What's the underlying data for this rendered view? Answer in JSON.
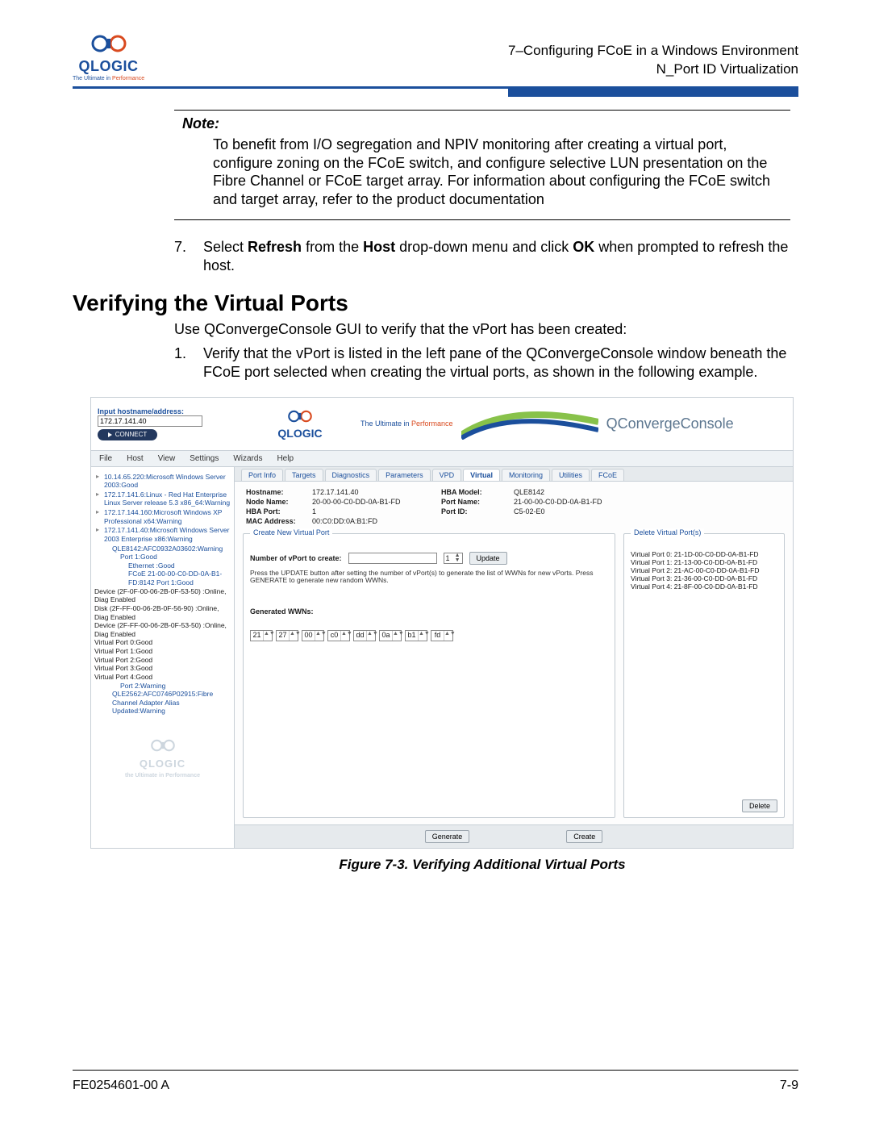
{
  "header": {
    "logo_text": "QLOGIC",
    "logo_sub_pre": "The Ultimate in ",
    "logo_sub_perf": "Performance",
    "line1": "7–Configuring FCoE in a Windows Environment",
    "line2": "N_Port ID Virtualization"
  },
  "note": {
    "title": "Note:",
    "body": "To benefit from I/O segregation and NPIV monitoring after creating a virtual port, configure zoning on the FCoE switch, and configure selective LUN presentation on the Fibre Channel or FCoE target array. For information about configuring the FCoE switch and target array, refer to the product documentation"
  },
  "step7": {
    "num": "7.",
    "pre": "Select ",
    "b1": "Refresh",
    "mid": " from the ",
    "b2": "Host",
    "mid2": " drop-down menu and click ",
    "b3": "OK",
    "post": " when prompted to refresh the host."
  },
  "section_title": "Verifying the Virtual Ports",
  "intro": "Use QConvergeConsole GUI to verify that the vPort has been created:",
  "step1": {
    "num": "1.",
    "text": "Verify that the vPort is listed in the left pane of the QConvergeConsole window beneath the FCoE port selected when creating the virtual ports, as shown in the following example."
  },
  "shot": {
    "addr_label": "Input hostname/address:",
    "addr_value": "172.17.141.40",
    "connect": "CONNECT",
    "brand_big": "QLOGIC",
    "tag_pre": "The Ultimate in ",
    "tag_perf": "Performance",
    "qcc": "QConvergeConsole",
    "menubar": [
      "File",
      "Host",
      "View",
      "Settings",
      "Wizards",
      "Help"
    ],
    "tree": [
      "10.14.65.220:Microsoft Windows Server 2003:Good",
      "172.17.141.6:Linux - Red Hat Enterprise Linux Server release 5.3 x86_64:Warning",
      "172.17.144.160:Microsoft Windows XP Professional x64:Warning",
      "172.17.141.40:Microsoft Windows Server 2003 Enterprise x86:Warning",
      "  QLE8142:AFC0932A03602:Warning",
      "    Port 1:Good",
      "      Ethernet :Good",
      "      FCoE 21-00-00-C0-DD-0A-B1-FD:8142 Port 1:Good",
      "        Device (2F-0F-00-06-2B-0F-53-50) :Online, Diag Enabled",
      "        Disk (2F-FF-00-06-2B-0F-56-90) :Online, Diag Enabled",
      "        Device (2F-FF-00-06-2B-0F-53-50) :Online, Diag Enabled",
      "        Virtual Port 0:Good",
      "        Virtual Port 1:Good",
      "        Virtual Port 2:Good",
      "        Virtual Port 3:Good",
      "        Virtual Port 4:Good",
      "    Port 2:Warning",
      "  QLE2562:AFC0746P02915:Fibre Channel Adapter Alias Updated:Warning"
    ],
    "watermark": "QLOGIC",
    "watermark_sub": "the Ultimate in Performance",
    "tabs": [
      "Port Info",
      "Targets",
      "Diagnostics",
      "Parameters",
      "VPD",
      "Virtual",
      "Monitoring",
      "Utilities",
      "FCoE"
    ],
    "active_tab": 5,
    "info": {
      "Hostname": "172.17.141.40",
      "Node Name": "20-00-00-C0-DD-0A-B1-FD",
      "HBA Port": "1",
      "MAC Address": "00:C0:DD:0A:B1:FD",
      "HBA Model": "QLE8142",
      "Port Name": "21-00-00-C0-DD-0A-B1-FD",
      "Port ID": "C5-02-E0"
    },
    "left_panel_title": "Create New Virtual Port",
    "np_label": "Number of vPort to create:",
    "np_value": "1",
    "update_btn": "Update",
    "hint": "Press the UPDATE button after setting the number of vPort(s) to generate the list of WWNs for new vPorts. Press GENERATE to generate new random WWNs.",
    "gen_label": "Generated WWNs:",
    "wwn": [
      "21",
      "27",
      "00",
      "c0",
      "dd",
      "0a",
      "b1",
      "fd"
    ],
    "right_panel_title": "Delete Virtual Port(s)",
    "vp_list": [
      "Virtual Port 0: 21-1D-00-C0-DD-0A-B1-FD",
      "Virtual Port 1: 21-13-00-C0-DD-0A-B1-FD",
      "Virtual Port 2: 21-AC-00-C0-DD-0A-B1-FD",
      "Virtual Port 3: 21-36-00-C0-DD-0A-B1-FD",
      "Virtual Port 4: 21-8F-00-C0-DD-0A-B1-FD"
    ],
    "btn_delete": "Delete",
    "btn_generate": "Generate",
    "btn_create": "Create"
  },
  "caption": "Figure 7-3. Verifying Additional Virtual Ports",
  "footer": {
    "left": "FE0254601-00 A",
    "right": "7-9"
  }
}
